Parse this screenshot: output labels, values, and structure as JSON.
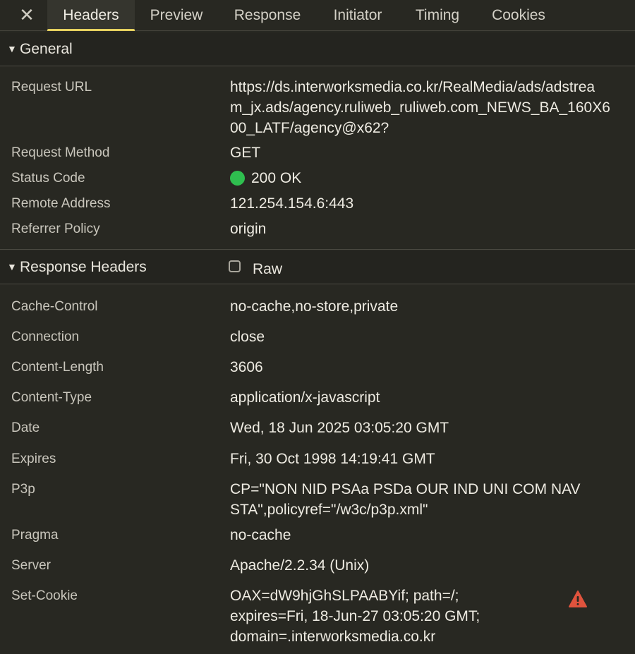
{
  "tabs": [
    {
      "label": "Headers",
      "active": true
    },
    {
      "label": "Preview",
      "active": false
    },
    {
      "label": "Response",
      "active": false
    },
    {
      "label": "Initiator",
      "active": false
    },
    {
      "label": "Timing",
      "active": false
    },
    {
      "label": "Cookies",
      "active": false
    }
  ],
  "close_icon": "close-icon",
  "general": {
    "title": "General",
    "rows": [
      {
        "key": "Request URL",
        "value_lines": [
          "https://ds.interworksmedia.co.kr/RealMedia/ads/adstrea",
          "m_jx.ads/agency.ruliweb_ruliweb.com_NEWS_BA_160X6",
          "00_LATF/agency@x62?"
        ]
      },
      {
        "key": "Request Method",
        "value_lines": [
          "GET"
        ]
      },
      {
        "key": "Status Code",
        "value_lines": [
          "200 OK"
        ],
        "status_color": "#2fbf4f"
      },
      {
        "key": "Remote Address",
        "value_lines": [
          "121.254.154.6:443"
        ]
      },
      {
        "key": "Referrer Policy",
        "value_lines": [
          "origin"
        ]
      }
    ]
  },
  "response_headers": {
    "title": "Response Headers",
    "raw_label": "Raw",
    "raw_checked": false,
    "rows": [
      {
        "key": "Cache-Control",
        "value_lines": [
          "no-cache,no-store,private"
        ]
      },
      {
        "key": "Connection",
        "value_lines": [
          "close"
        ]
      },
      {
        "key": "Content-Length",
        "value_lines": [
          "3606"
        ]
      },
      {
        "key": "Content-Type",
        "value_lines": [
          "application/x-javascript"
        ]
      },
      {
        "key": "Date",
        "value_lines": [
          "Wed, 18 Jun 2025 03:05:20 GMT"
        ]
      },
      {
        "key": "Expires",
        "value_lines": [
          "Fri, 30 Oct 1998 14:19:41 GMT"
        ]
      },
      {
        "key": "P3p",
        "value_lines": [
          "CP=\"NON NID PSAa PSDa OUR IND UNI COM NAV",
          "STA\",policyref=\"/w3c/p3p.xml\""
        ]
      },
      {
        "key": "Pragma",
        "value_lines": [
          "no-cache"
        ]
      },
      {
        "key": "Server",
        "value_lines": [
          "Apache/2.2.34 (Unix)"
        ]
      },
      {
        "key": "Set-Cookie",
        "value_lines": [
          "OAX=dW9hjGhSLPAABYif; path=/;",
          "expires=Fri, 18-Jun-27 03:05:20 GMT;",
          "domain=.interworksmedia.co.kr"
        ],
        "warning_icon": "warning-triangle-icon",
        "warning_color": "#e0533d"
      }
    ]
  }
}
